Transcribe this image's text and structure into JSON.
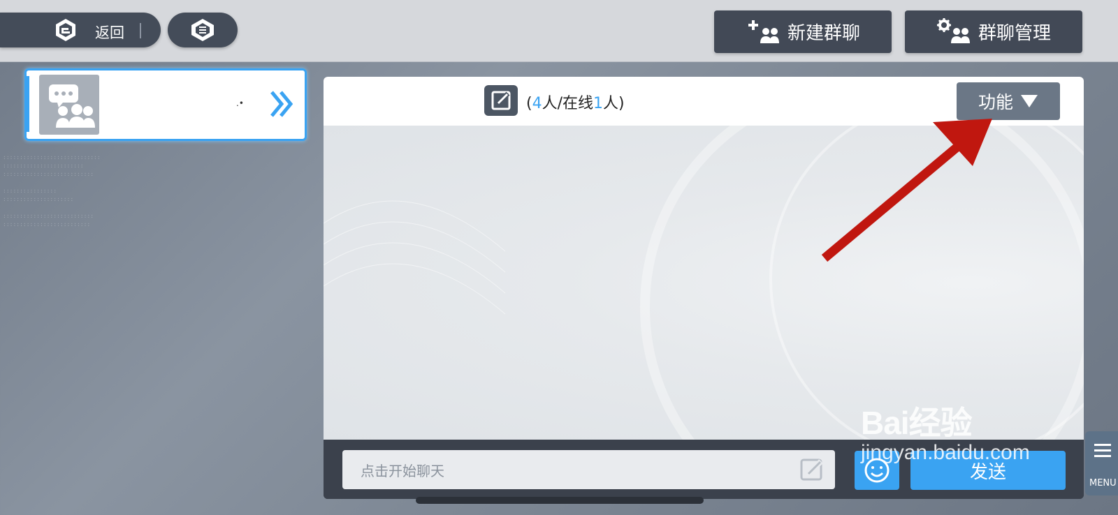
{
  "topbar": {
    "back_label": "返回",
    "new_group_label": "新建群聊",
    "manage_group_label": "群聊管理"
  },
  "group_list": {
    "items": [
      {
        "name": ".•"
      }
    ]
  },
  "chat": {
    "header": {
      "member_total": "4",
      "member_online": "1",
      "member_text_open": "(",
      "member_text_mid": "人/在线",
      "member_text_close": "人)",
      "function_label": "功能"
    },
    "input_placeholder": "点击开始聊天",
    "send_label": "发送"
  },
  "menu": {
    "label": "MENU"
  },
  "watermark": {
    "line1": "Bai经验",
    "line2": "jingyan.baidu.com"
  },
  "colors": {
    "accent": "#3aa3f2",
    "dark_button": "#424956",
    "annotation_arrow": "#c0170f"
  },
  "icons": {
    "back_logo": "app-logo-icon",
    "home": "home-logo-icon",
    "new_group": "add-group-icon",
    "manage_group": "group-settings-icon",
    "group_avatar": "group-chat-icon",
    "expand": "double-chevron-right-icon",
    "edit": "edit-icon",
    "dropdown": "triangle-down-icon",
    "emoji": "emoji-icon",
    "menu": "menu-icon"
  }
}
